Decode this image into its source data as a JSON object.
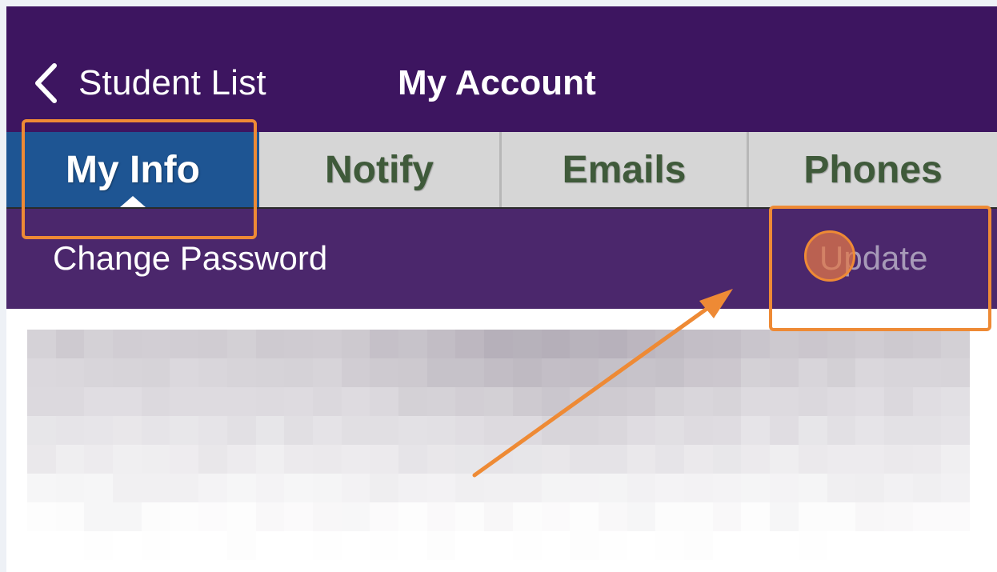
{
  "header": {
    "back_label": "Student List",
    "title": "My Account"
  },
  "tabs": [
    {
      "label": "My Info",
      "active": true
    },
    {
      "label": "Notify",
      "active": false
    },
    {
      "label": "Emails",
      "active": false
    },
    {
      "label": "Phones",
      "active": false
    }
  ],
  "actions": {
    "change_password_label": "Change Password",
    "update_label": "Update",
    "update_enabled": false
  },
  "colors": {
    "navbar": "#3d1560",
    "action_row": "#4b276c",
    "active_tab": "#1e5593",
    "inactive_tab_text": "#3f5a3a",
    "annotation": "#ee8a35"
  },
  "icons": {
    "back": "chevron-left-icon"
  },
  "content": {
    "obscured": true
  }
}
